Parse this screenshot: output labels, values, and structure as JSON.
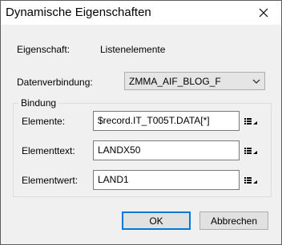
{
  "dialog": {
    "title": "Dynamische Eigenschaften",
    "property_label": "Eigenschaft:",
    "property_value": "Listenelemente",
    "datasource_label": "Datenverbindung:",
    "datasource_value": "ZMMA_AIF_BLOG_F",
    "group_title": "Bindung",
    "fields": [
      {
        "label": "Elemente:",
        "value": "$record.IT_T005T.DATA[*]"
      },
      {
        "label": "Elementtext:",
        "value": "LANDX50"
      },
      {
        "label": "Elementwert:",
        "value": "LAND1"
      }
    ],
    "ok_label": "OK",
    "cancel_label": "Abbrechen"
  },
  "icons": {
    "close": "close-icon",
    "dropdown": "chevron-down-icon",
    "list_options": "list-options-icon"
  }
}
